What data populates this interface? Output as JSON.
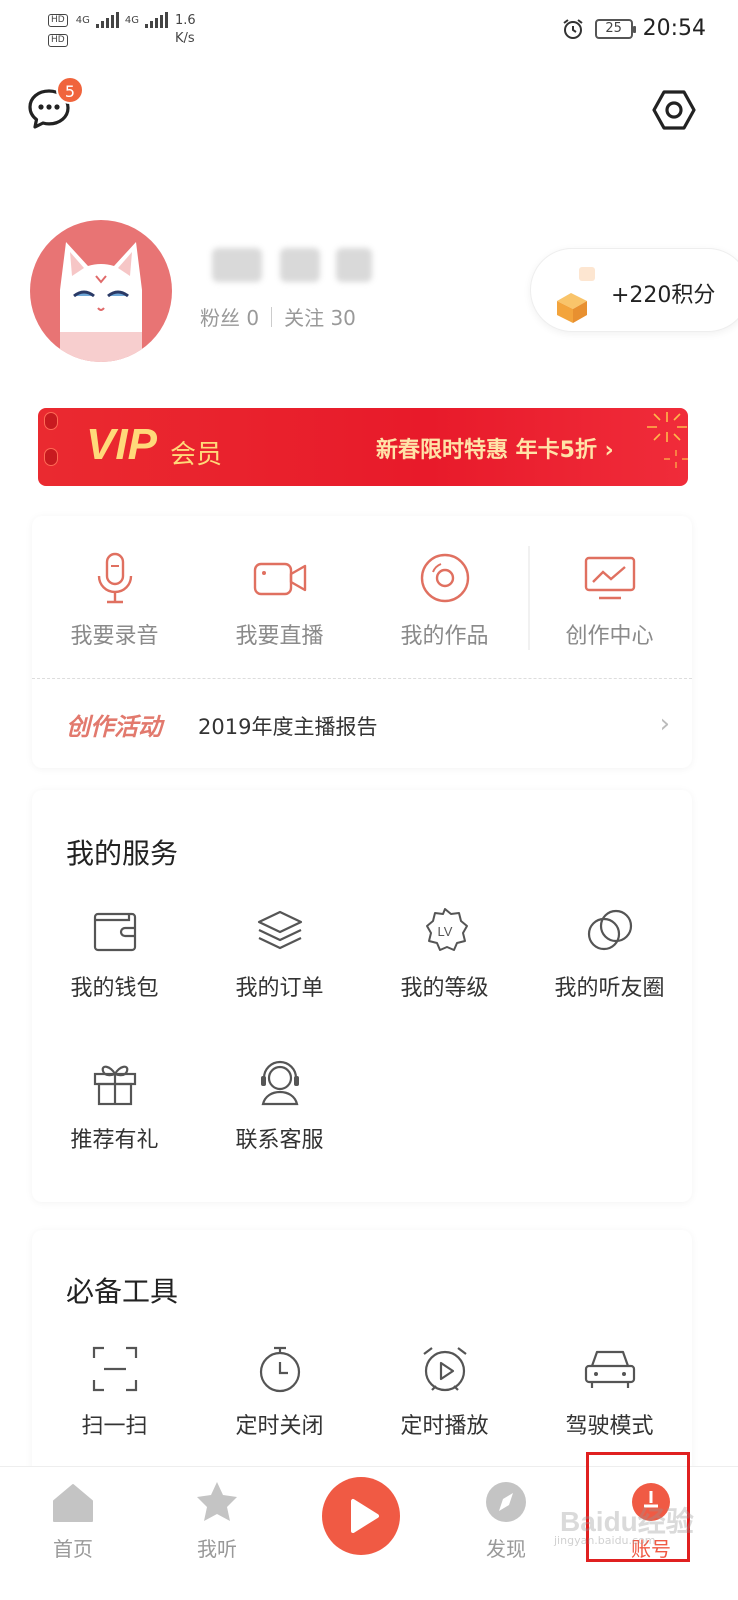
{
  "status_bar": {
    "hd1": "HD",
    "hd2": "HD",
    "net1": "4G",
    "net2": "4G",
    "speed_value": "1.6",
    "speed_unit": "K/s",
    "battery": "25",
    "time": "20:54"
  },
  "header": {
    "message_badge": "5"
  },
  "profile": {
    "fans": "粉丝 0",
    "following": "关注 30",
    "points": "+220积分"
  },
  "vip": {
    "title": "VIP",
    "subtitle": "会员",
    "promo": "新春限时特惠  年卡5折 ›"
  },
  "creator": {
    "items": [
      {
        "label": "我要录音",
        "icon": "microphone-icon"
      },
      {
        "label": "我要直播",
        "icon": "video-camera-icon"
      },
      {
        "label": "我的作品",
        "icon": "disc-icon"
      },
      {
        "label": "创作中心",
        "icon": "monitor-chart-icon"
      }
    ],
    "activity_tag": "创作活动",
    "activity_text": "2019年度主播报告"
  },
  "services": {
    "title": "我的服务",
    "items": [
      {
        "label": "我的钱包",
        "icon": "wallet-icon"
      },
      {
        "label": "我的订单",
        "icon": "layers-icon"
      },
      {
        "label": "我的等级",
        "icon": "level-badge-icon"
      },
      {
        "label": "我的听友圈",
        "icon": "circles-icon"
      },
      {
        "label": "推荐有礼",
        "icon": "gift-icon"
      },
      {
        "label": "联系客服",
        "icon": "headset-icon"
      }
    ]
  },
  "tools": {
    "title": "必备工具",
    "items": [
      {
        "label": "扫一扫",
        "icon": "scan-icon"
      },
      {
        "label": "定时关闭",
        "icon": "timer-icon"
      },
      {
        "label": "定时播放",
        "icon": "alarm-play-icon"
      },
      {
        "label": "驾驶模式",
        "icon": "car-icon"
      }
    ]
  },
  "tabbar": {
    "home": "首页",
    "listen": "我听",
    "discover": "发现",
    "account": "账号"
  },
  "watermark": {
    "main": "Baidu经验",
    "sub": "jingyan.baidu.com"
  },
  "colors": {
    "accent": "#f05a44",
    "vip_red": "#e8202a",
    "vip_gold": "#ffd97a",
    "highlight": "#e02020"
  }
}
